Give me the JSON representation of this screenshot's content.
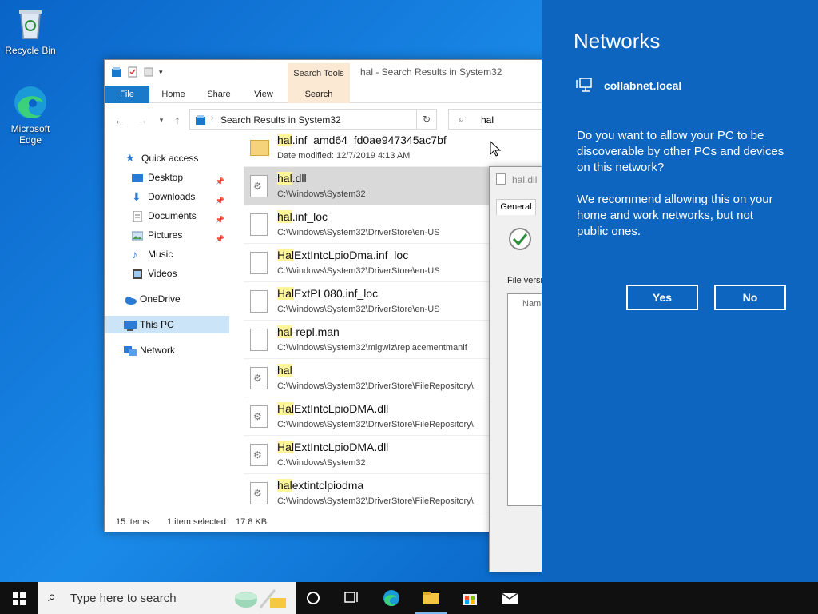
{
  "desktop": {
    "recycle_bin": "Recycle Bin",
    "edge_line1": "Microsoft",
    "edge_line2": "Edge"
  },
  "explorer": {
    "context_tab_group": "Search Tools",
    "title": "hal - Search Results in System32",
    "ribbon_tabs": [
      "File",
      "Home",
      "Share",
      "View",
      "Search"
    ],
    "address": "Search Results in System32",
    "search_value": "hal",
    "nav": {
      "quick_access": "Quick access",
      "desktop": "Desktop",
      "downloads": "Downloads",
      "documents": "Documents",
      "pictures": "Pictures",
      "music": "Music",
      "videos": "Videos",
      "onedrive": "OneDrive",
      "this_pc": "This PC",
      "network": "Network"
    },
    "files": [
      {
        "hl": "hal",
        "rest": ".inf_amd64_fd0ae947345ac7bf",
        "path": "Date modified:  12/7/2019 4:13 AM"
      },
      {
        "hl": "hal",
        "rest": ".dll",
        "path": "C:\\Windows\\System32"
      },
      {
        "hl": "hal",
        "rest": ".inf_loc",
        "path": "C:\\Windows\\System32\\DriverStore\\en-US"
      },
      {
        "hl": "Hal",
        "rest": "ExtIntcLpioDma.inf_loc",
        "path": "C:\\Windows\\System32\\DriverStore\\en-US"
      },
      {
        "hl": "Hal",
        "rest": "ExtPL080.inf_loc",
        "path": "C:\\Windows\\System32\\DriverStore\\en-US"
      },
      {
        "hl": "hal",
        "rest": "-repl.man",
        "path": "C:\\Windows\\System32\\migwiz\\replacementmanif"
      },
      {
        "hl": "hal",
        "rest": "",
        "path": "C:\\Windows\\System32\\DriverStore\\FileRepository\\"
      },
      {
        "hl": "Hal",
        "rest": "ExtIntcLpioDMA.dll",
        "path": "C:\\Windows\\System32\\DriverStore\\FileRepository\\"
      },
      {
        "hl": "Hal",
        "rest": "ExtIntcLpioDMA.dll",
        "path": "C:\\Windows\\System32"
      },
      {
        "hl": "hal",
        "rest": "extintclpiodma",
        "path": "C:\\Windows\\System32\\DriverStore\\FileRepository\\"
      }
    ],
    "status": {
      "items": "15 items",
      "selected": "1 item selected",
      "size": "17.8 KB"
    }
  },
  "properties": {
    "title": "hal.dll",
    "tab": "General",
    "file_version_label": "File versio",
    "list_header": "Nam"
  },
  "networks": {
    "title": "Networks",
    "network_name": "collabnet.local",
    "prompt_lines": [
      "Do you want to allow your PC to be",
      "discoverable by other PCs and devices",
      "on this network?"
    ],
    "recommend_lines": [
      "We recommend allowing this on your",
      "home and work networks, but not",
      "public ones."
    ],
    "yes_label": "Yes",
    "no_label": "No"
  },
  "taskbar": {
    "search_placeholder": "Type here to search"
  },
  "colors": {
    "accent": "#0e65c0",
    "file_tab": "#1979ca",
    "search_tools": "#fbe9d4",
    "highlight": "#fff59a"
  }
}
